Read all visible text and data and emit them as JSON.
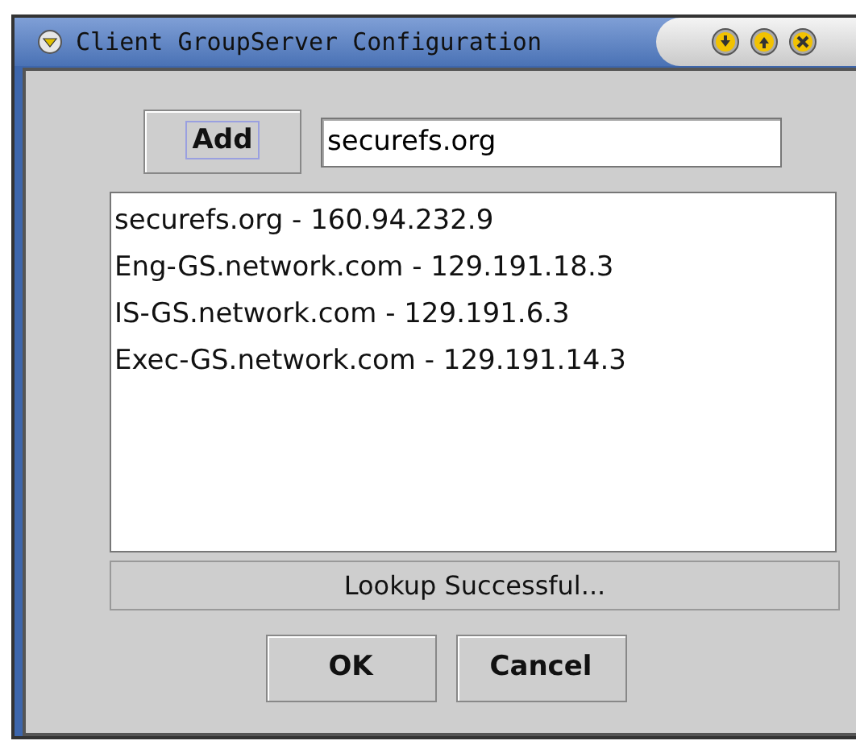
{
  "window": {
    "title": "Client GroupServer Configuration"
  },
  "add_button": {
    "label": "Add",
    "focused": true
  },
  "host_field": {
    "value": "securefs.org"
  },
  "servers": [
    {
      "label": "securefs.org - 160.94.232.9"
    },
    {
      "label": "Eng-GS.network.com - 129.191.18.3"
    },
    {
      "label": "IS-GS.network.com - 129.191.6.3"
    },
    {
      "label": "Exec-GS.network.com - 129.191.14.3"
    }
  ],
  "status_bar": "Lookup Successful...",
  "buttons": [
    {
      "label": "OK"
    },
    {
      "label": "Cancel"
    }
  ]
}
